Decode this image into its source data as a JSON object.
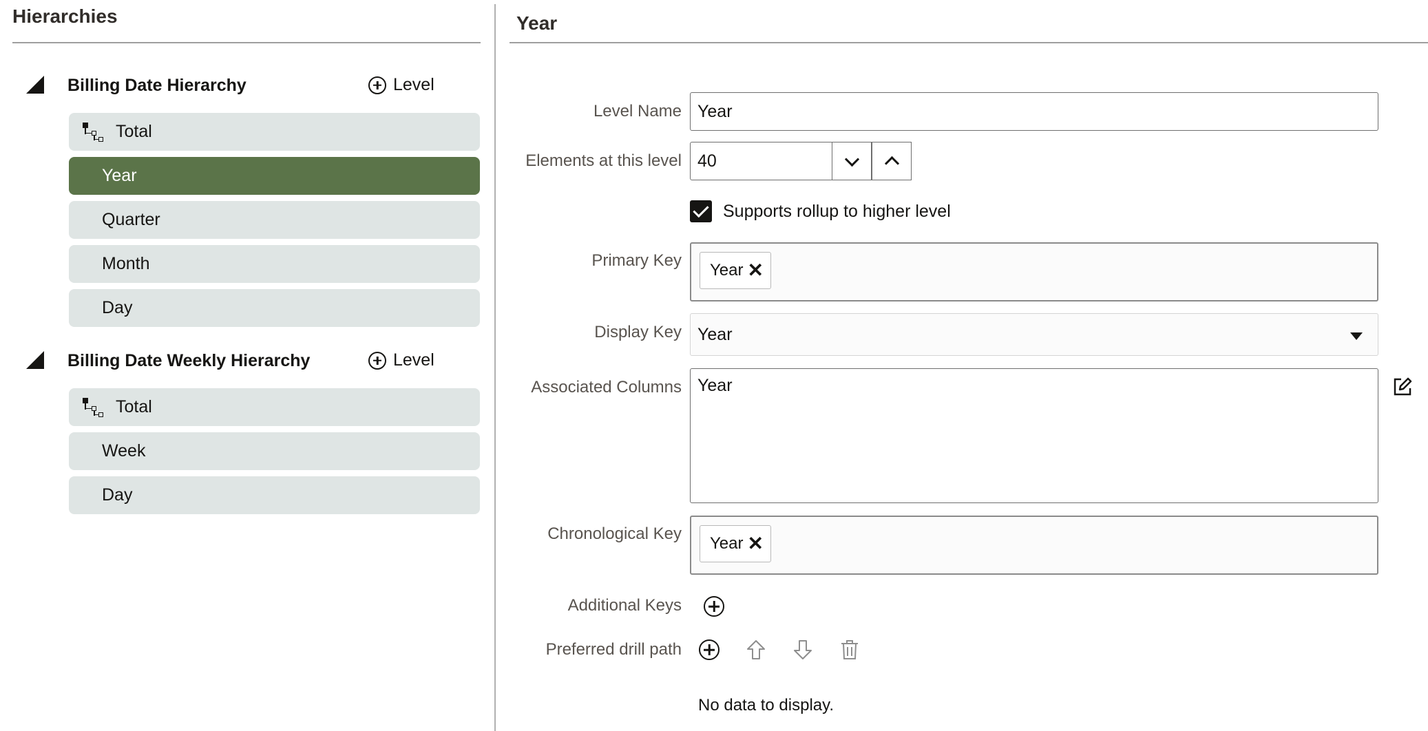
{
  "left_panel": {
    "title": "Hierarchies",
    "hierarchies": [
      {
        "name": "Billing Date Hierarchy",
        "add_level_label": "Level",
        "levels": [
          "Total",
          "Year",
          "Quarter",
          "Month",
          "Day"
        ],
        "selected_level": "Year"
      },
      {
        "name": "Billing Date Weekly Hierarchy",
        "add_level_label": "Level",
        "levels": [
          "Total",
          "Week",
          "Day"
        ]
      }
    ]
  },
  "right_panel": {
    "title": "Year",
    "fields": {
      "level_name_label": "Level Name",
      "level_name_value": "Year",
      "elements_label": "Elements at this level",
      "elements_value": "40",
      "rollup_label": "Supports rollup to higher level",
      "rollup_checked": true,
      "primary_key_label": "Primary Key",
      "primary_key_chip": "Year",
      "display_key_label": "Display Key",
      "display_key_value": "Year",
      "associated_columns_label": "Associated Columns",
      "associated_columns_value": "Year",
      "chronological_key_label": "Chronological Key",
      "chronological_key_chip": "Year",
      "additional_keys_label": "Additional Keys",
      "preferred_drill_path_label": "Preferred drill path",
      "empty_message": "No data to display."
    }
  },
  "colors": {
    "selected_level_bg": "#5b7449",
    "level_bg": "#dfe5e4"
  },
  "icons": [
    "collapse-triangle-icon",
    "add-circle-icon",
    "hierarchy-tree-icon",
    "chevron-down-icon",
    "chevron-up-icon",
    "checkmark-icon",
    "remove-x-icon",
    "dropdown-caret-icon",
    "edit-icon",
    "arrow-up-icon",
    "arrow-down-icon",
    "trash-icon"
  ]
}
